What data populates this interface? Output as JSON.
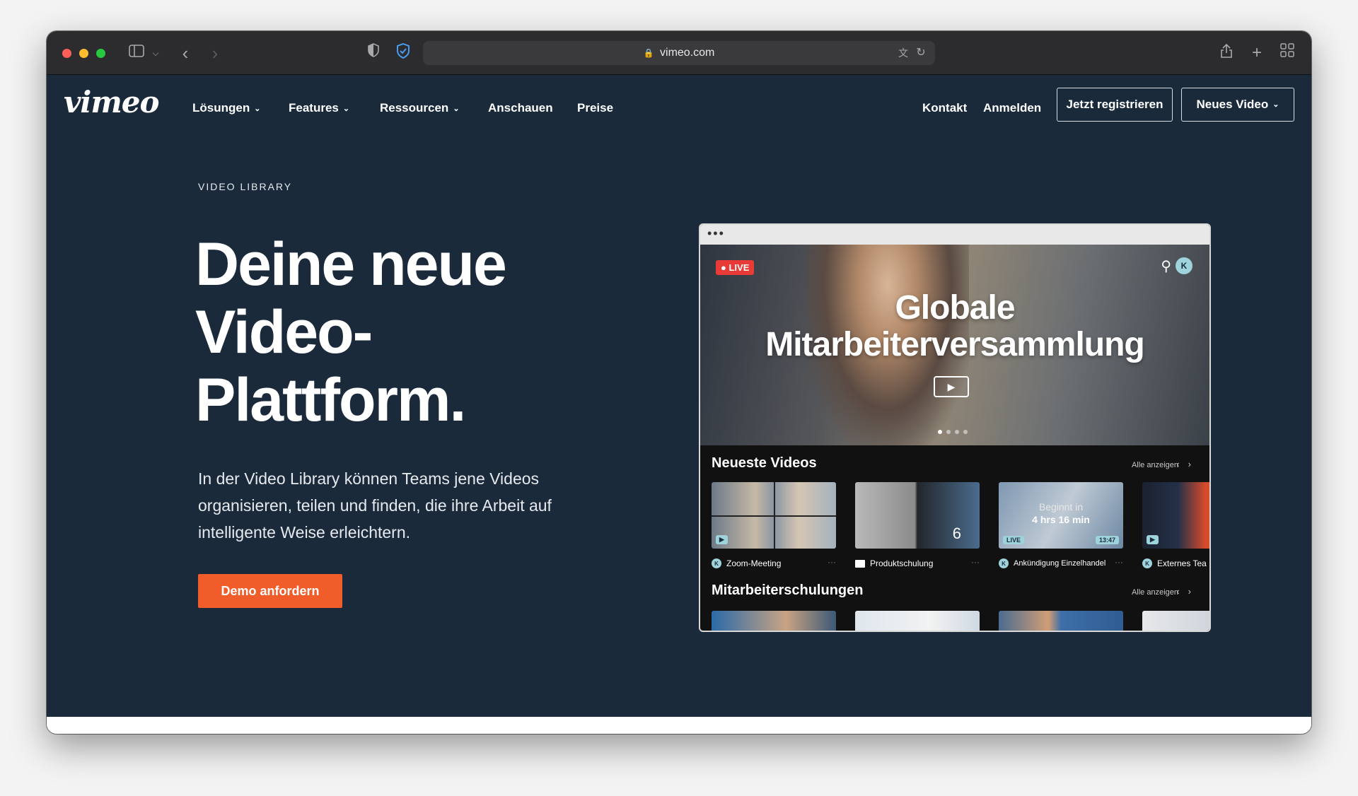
{
  "browser": {
    "url": "vimeo.com",
    "icons": [
      "sidebar-toggle-icon",
      "chevron-down-icon",
      "back-arrow-icon",
      "forward-arrow-icon",
      "shield-icon",
      "privacy-shield-icon",
      "lock-icon",
      "translate-icon",
      "reload-icon",
      "share-icon",
      "new-tab-icon",
      "tab-overview-icon"
    ]
  },
  "nav": {
    "logo": "vimeo",
    "items": [
      {
        "label": "Lösungen",
        "dropdown": true
      },
      {
        "label": "Features",
        "dropdown": true
      },
      {
        "label": "Ressourcen",
        "dropdown": true
      },
      {
        "label": "Anschauen",
        "dropdown": false
      },
      {
        "label": "Preise",
        "dropdown": false
      }
    ],
    "contact": "Kontakt",
    "login": "Anmelden",
    "register": "Jetzt registrieren",
    "new_video": "Neues Video"
  },
  "hero": {
    "eyebrow": "VIDEO LIBRARY",
    "headline_line1": "Deine neue",
    "headline_line2": "Video-",
    "headline_line3": "Plattform.",
    "body": "In der Video Library können Teams jene Videos organisieren, teilen und finden, die ihre Arbeit auf intelligente Weise erleichtern.",
    "cta": "Demo anfordern"
  },
  "mock": {
    "live_label": "LIVE",
    "banner_title_line1": "Globale",
    "banner_title_line2": "Mitarbeiterversammlung",
    "avatar_initial": "K",
    "section1": {
      "title": "Neueste Videos",
      "see_all": "Alle anzeigen",
      "videos": [
        {
          "title": "Zoom-Meeting",
          "owner": "K",
          "more": "···"
        },
        {
          "title": "Produktschulung",
          "folder": true,
          "more": "···",
          "count": "6"
        },
        {
          "title": "Ankündigung Einzelhandel",
          "owner": "K",
          "more": "···",
          "overlay_top": "Beginnt in",
          "overlay_main": "4 hrs 16 min",
          "badge": "LIVE",
          "duration": "13:47"
        },
        {
          "title": "Externes Tea",
          "owner": "K"
        }
      ]
    },
    "section2": {
      "title": "Mitarbeiterschulungen",
      "see_all": "Alle anzeigen"
    }
  },
  "colors": {
    "page_bg": "#1a2a3b",
    "cta": "#f15d2a",
    "live_red": "#e83a36",
    "accent_teal": "#9fd3dc"
  }
}
